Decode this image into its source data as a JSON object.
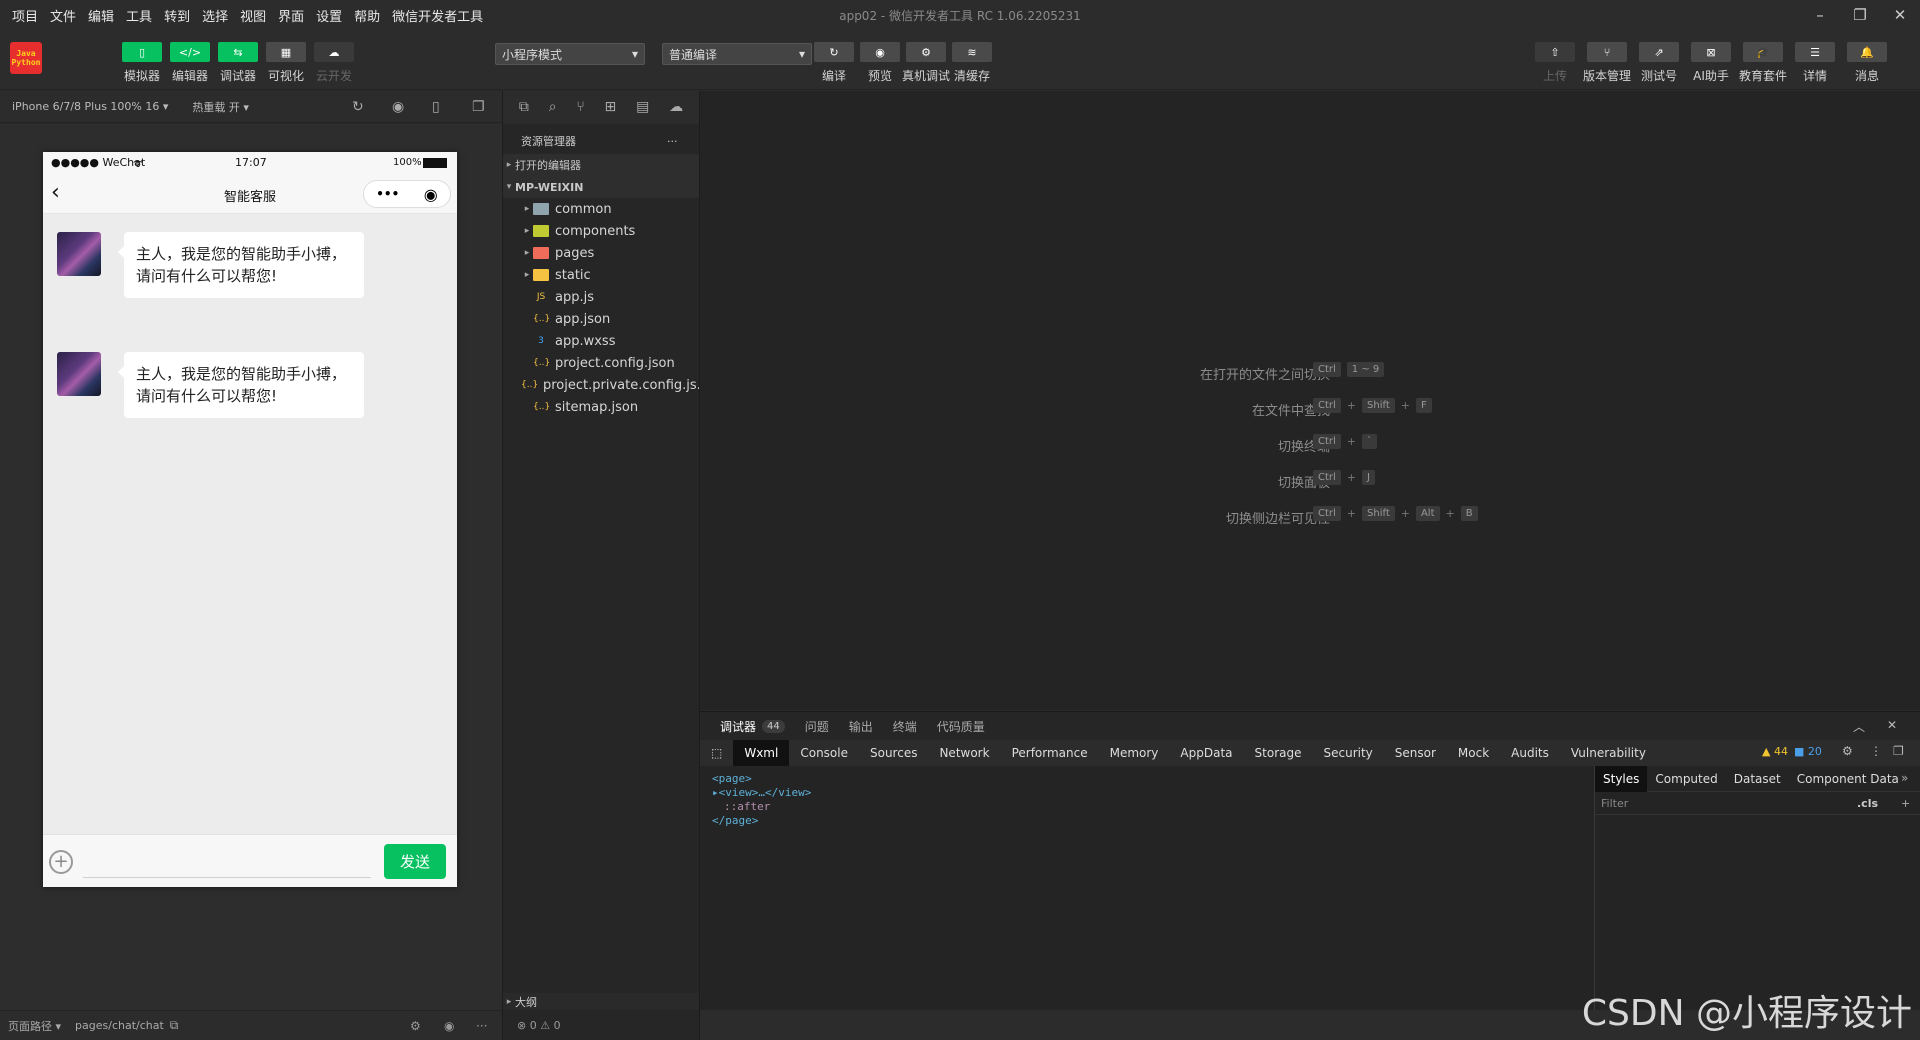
{
  "menubar": {
    "items": [
      "项目",
      "文件",
      "编辑",
      "工具",
      "转到",
      "选择",
      "视图",
      "界面",
      "设置",
      "帮助",
      "微信开发者工具"
    ],
    "title": "app02 - 微信开发者工具 RC 1.06.2205231"
  },
  "logo": {
    "line1": "Java",
    "line2": "Python"
  },
  "toolbar": {
    "left": [
      {
        "label": "模拟器",
        "glyph": "▯"
      },
      {
        "label": "编辑器",
        "glyph": "</>"
      },
      {
        "label": "调试器",
        "glyph": "⇆"
      },
      {
        "label": "可视化",
        "glyph": "▦"
      },
      {
        "label": "云开发",
        "glyph": "☁"
      }
    ],
    "mode_select": "小程序模式",
    "compile_select": "普通编译",
    "center": [
      {
        "label": "编译",
        "glyph": "↻"
      },
      {
        "label": "预览",
        "glyph": "◉"
      },
      {
        "label": "真机调试",
        "glyph": "⚙"
      },
      {
        "label": "清缓存",
        "glyph": "≋"
      }
    ],
    "right": [
      {
        "label": "上传",
        "glyph": "⇧"
      },
      {
        "label": "版本管理",
        "glyph": "⑂"
      },
      {
        "label": "测试号",
        "glyph": "⇗"
      },
      {
        "label": "AI助手",
        "glyph": "⊠"
      },
      {
        "label": "教育套件",
        "glyph": "🎓"
      },
      {
        "label": "详情",
        "glyph": "☰"
      },
      {
        "label": "消息",
        "glyph": "🔔"
      }
    ]
  },
  "simbar": {
    "device": "iPhone 6/7/8 Plus 100% 16 ▾",
    "hotreload": "热重载 开 ▾"
  },
  "phone": {
    "carrier": "●●●●● WeChat",
    "time": "17:07",
    "battery": "100%",
    "nav_title": "智能客服",
    "messages": [
      {
        "text": "主人，我是您的智能助手小搏，请问有什么可以帮您!"
      },
      {
        "text": "主人，我是您的智能助手小搏，请问有什么可以帮您!"
      }
    ],
    "send_label": "发送"
  },
  "explorer": {
    "title": "资源管理器",
    "open_editors": "打开的编辑器",
    "root": "MP-WEIXIN",
    "items": [
      {
        "name": "common",
        "kind": "folder",
        "color": "#90a4ae"
      },
      {
        "name": "components",
        "kind": "folder",
        "color": "#c0ca33"
      },
      {
        "name": "pages",
        "kind": "folder",
        "color": "#ef6c5a"
      },
      {
        "name": "static",
        "kind": "folder",
        "color": "#f5c242"
      },
      {
        "name": "app.js",
        "kind": "file",
        "glyph": "JS",
        "color": "#f5c242"
      },
      {
        "name": "app.json",
        "kind": "file",
        "glyph": "{..}",
        "color": "#f5c242"
      },
      {
        "name": "app.wxss",
        "kind": "file",
        "glyph": "3",
        "color": "#42a5f5"
      },
      {
        "name": "project.config.json",
        "kind": "file",
        "glyph": "{..}",
        "color": "#f5c242"
      },
      {
        "name": "project.private.config.js...",
        "kind": "file",
        "glyph": "{..}",
        "color": "#f5c242"
      },
      {
        "name": "sitemap.json",
        "kind": "file",
        "glyph": "{..}",
        "color": "#f5c242"
      }
    ],
    "outline": "大纲",
    "status": "⊗ 0 ⚠ 0"
  },
  "shortcuts": [
    {
      "label": "在打开的文件之间切换",
      "keys": [
        "Ctrl",
        "1 ~ 9"
      ],
      "joiner": " "
    },
    {
      "label": "在文件中查找",
      "keys": [
        "Ctrl",
        "Shift",
        "F"
      ],
      "joiner": "+"
    },
    {
      "label": "切换终端",
      "keys": [
        "Ctrl",
        "`"
      ],
      "joiner": "+"
    },
    {
      "label": "切换面板",
      "keys": [
        "Ctrl",
        "J"
      ],
      "joiner": "+"
    },
    {
      "label": "切换侧边栏可见性",
      "keys": [
        "Ctrl",
        "Shift",
        "Alt",
        "B"
      ],
      "joiner": "+"
    }
  ],
  "debugger": {
    "tabs": [
      "调试器",
      "问题",
      "输出",
      "终端",
      "代码质量"
    ],
    "badge": "44",
    "devtabs": [
      "Wxml",
      "Console",
      "Sources",
      "Network",
      "Performance",
      "Memory",
      "AppData",
      "Storage",
      "Security",
      "Sensor",
      "Mock",
      "Audits",
      "Vulnerability"
    ],
    "warnings": "▲ 44",
    "infos": "■ 20",
    "wxml": [
      "<page>",
      "▸<view>…</view>",
      "::after",
      "</page>"
    ],
    "style_tabs": [
      "Styles",
      "Computed",
      "Dataset",
      "Component Data"
    ],
    "filter": "Filter",
    "cls": ".cls"
  },
  "sim_status": {
    "path_label": "页面路径 ▾",
    "path": "pages/chat/chat"
  },
  "watermark": "CSDN @小程序设计"
}
